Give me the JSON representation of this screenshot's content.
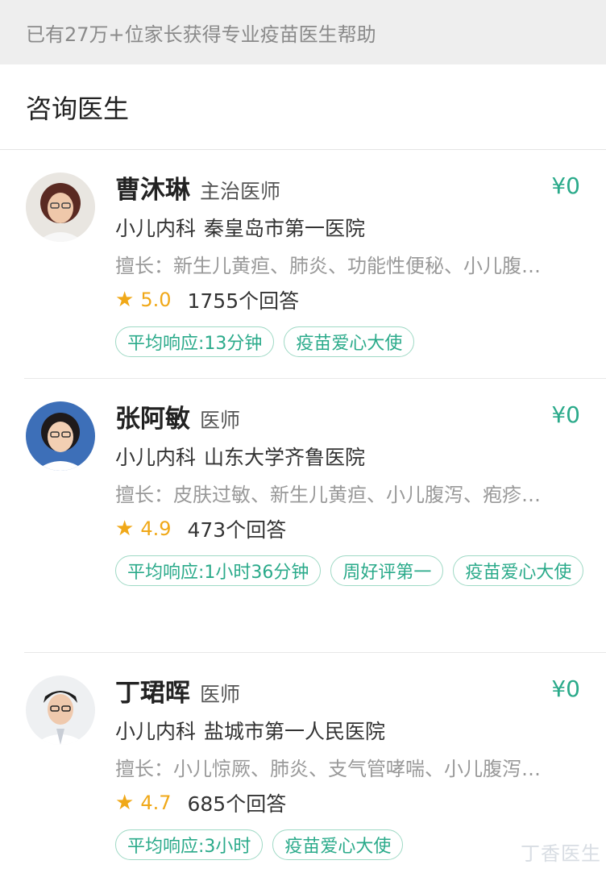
{
  "banner": {
    "text": "已有27万+位家长获得专业疫苗医生帮助"
  },
  "section": {
    "title": "咨询医生"
  },
  "doctors": [
    {
      "name": "曹沐琳",
      "title": "主治医师",
      "price": "¥0",
      "department": "小儿内科",
      "hospital": "秦皇岛市第一医院",
      "skills": "擅长：新生儿黄疸、肺炎、功能性便秘、小儿腹…",
      "rating": "5.0",
      "answers": "1755个回答",
      "tags": [
        "平均响应:13分钟",
        "疫苗爱心大使"
      ]
    },
    {
      "name": "张阿敏",
      "title": "医师",
      "price": "¥0",
      "department": "小儿内科",
      "hospital": "山东大学齐鲁医院",
      "skills": "擅长：皮肤过敏、新生儿黄疸、小儿腹泻、疱疹…",
      "rating": "4.9",
      "answers": "473个回答",
      "tags": [
        "平均响应:1小时36分钟",
        "周好评第一",
        "疫苗爱心大使"
      ]
    },
    {
      "name": "丁珺晖",
      "title": "医师",
      "price": "¥0",
      "department": "小儿内科",
      "hospital": "盐城市第一人民医院",
      "skills": "擅长：小儿惊厥、肺炎、支气管哮喘、小儿腹泻…",
      "rating": "4.7",
      "answers": "685个回答",
      "tags": [
        "平均响应:3小时",
        "疫苗爱心大使"
      ]
    }
  ],
  "icons": {
    "rating": "star-icon",
    "avatar": "doctor-avatar"
  },
  "colors": {
    "accent": "#2aaa8a",
    "star": "#f0a818",
    "muted": "#999999"
  },
  "watermark": {
    "text": "丁香医生"
  }
}
